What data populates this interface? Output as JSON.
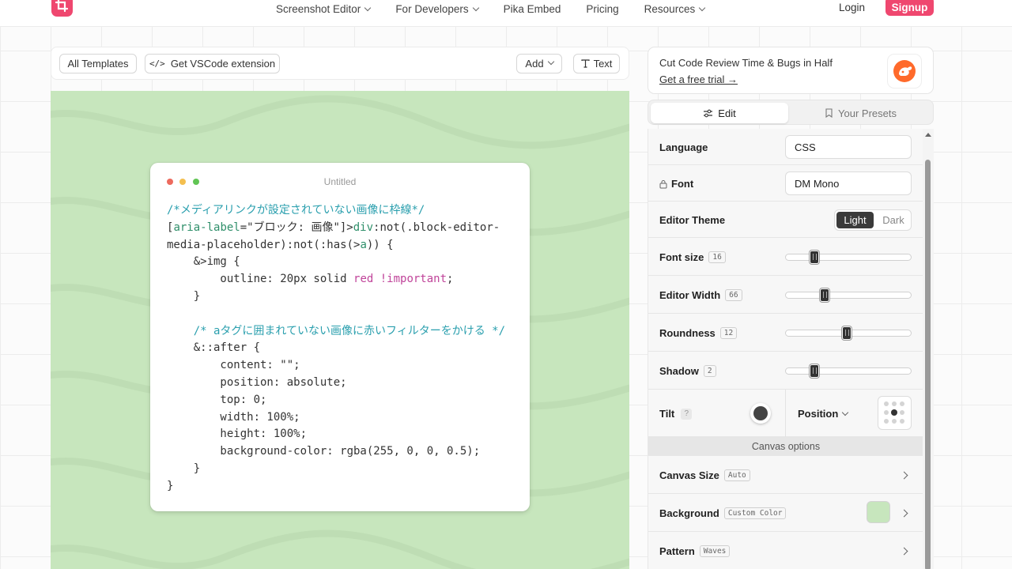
{
  "nav": {
    "links": [
      {
        "label": "Screenshot Editor",
        "dropdown": true
      },
      {
        "label": "For Developers",
        "dropdown": true
      },
      {
        "label": "Pika Embed",
        "dropdown": false
      },
      {
        "label": "Pricing",
        "dropdown": false
      },
      {
        "label": "Resources",
        "dropdown": true
      }
    ],
    "login": "Login",
    "signup": "Signup",
    "brand_color": "#ef476f"
  },
  "toolbar": {
    "all_templates": "All Templates",
    "vscode_icon": "</>",
    "vscode": "Get VSCode extension",
    "add": "Add",
    "text": "Text"
  },
  "canvas": {
    "background_color": "#c7e6bd",
    "window_title": "Untitled",
    "traffic_lights": [
      "#ed6a5e",
      "#f4bf4f",
      "#61c554"
    ]
  },
  "code_lines": [
    "/*メディアリンクが設定されていない画像に枠線*/",
    "[aria-label=\"ブロック: 画像\"]>div:not(.block-editor-",
    "media-placeholder):not(:has(>a)) {",
    "    &>img {",
    "        outline: 20px solid red !important;",
    "    }",
    "",
    "    /* aタグに囲まれていない画像に赤いフィルターをかける */",
    "    &::after {",
    "        content: \"\";",
    "        position: absolute;",
    "        top: 0;",
    "        width: 100%;",
    "        height: 100%;",
    "        background-color: rgba(255, 0, 0, 0.5);",
    "    }",
    "}"
  ],
  "promo": {
    "title": "Cut Code Review Time & Bugs in Half",
    "link": "Get a free trial →"
  },
  "tabs": {
    "edit": "Edit",
    "presets": "Your Presets"
  },
  "settings": {
    "language_label": "Language",
    "language_value": "CSS",
    "font_label": "Font",
    "font_value": "DM Mono",
    "theme_label": "Editor Theme",
    "theme_light": "Light",
    "theme_dark": "Dark",
    "font_size_label": "Font size",
    "font_size_value": "16",
    "font_size_fraction": 0.2,
    "editor_width_label": "Editor Width",
    "editor_width_value": "66",
    "editor_width_fraction": 0.29,
    "roundness_label": "Roundness",
    "roundness_value": "12",
    "roundness_fraction": 0.48,
    "shadow_label": "Shadow",
    "shadow_value": "2",
    "shadow_fraction": 0.2,
    "tilt_label": "Tilt",
    "tilt_help": "?",
    "position_label": "Position",
    "canvas_options": "Canvas options",
    "canvas_size_label": "Canvas Size",
    "canvas_size_value": "Auto",
    "background_label": "Background",
    "background_value": "Custom Color",
    "background_swatch": "#c7e6bd",
    "pattern_label": "Pattern",
    "pattern_value": "Waves"
  }
}
